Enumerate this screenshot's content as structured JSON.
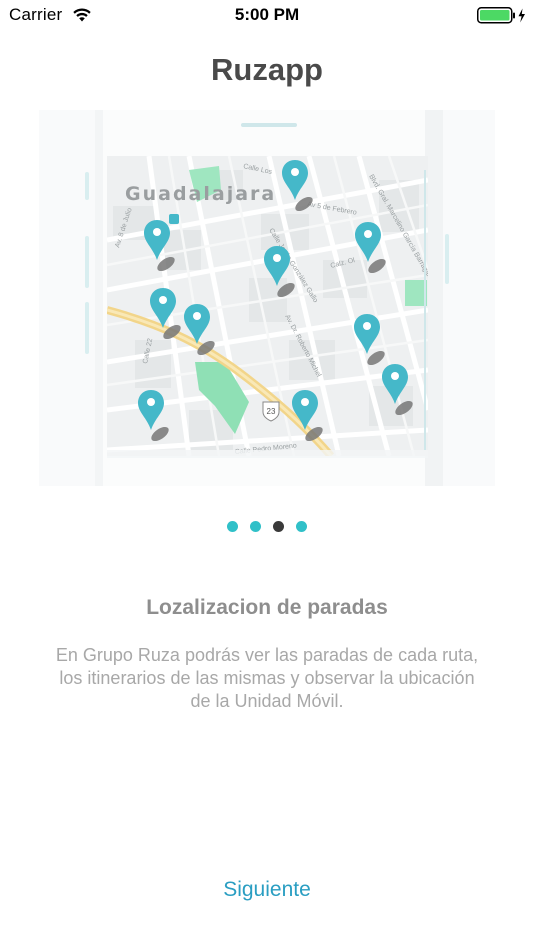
{
  "status_bar": {
    "carrier": "Carrier",
    "time": "5:00 PM",
    "battery_color": "#4cd964"
  },
  "app": {
    "title": "Ruzapp"
  },
  "illustration": {
    "city_label": "Guadalajara",
    "street_labels": [
      "Calle Los",
      "Av 5 de Febrero",
      "Blvd. Gral. Marcelino García Barragán",
      "Calle Jesús González Gallo",
      "Av. Dr. Roberto Michel",
      "Calz. Ol",
      "Av. 8 de Julio",
      "Calle 22",
      "Calle Pedro Moreno",
      "23"
    ],
    "marker_color": "#45b8c9",
    "park_color": "#8fe0b5",
    "highway_color": "#f2d58a"
  },
  "pagination": {
    "total": 4,
    "current": 3,
    "active_color": "#3a3a3a",
    "inactive_color": "#30c0c8"
  },
  "content": {
    "heading": "Lozalizacion de paradas",
    "body": "En Grupo Ruza podrás ver las paradas de cada ruta, los itinerarios de las mismas y observar la ubicación de la Unidad Móvil."
  },
  "actions": {
    "next_label": "Siguiente",
    "accent_color": "#2a9ec2"
  }
}
